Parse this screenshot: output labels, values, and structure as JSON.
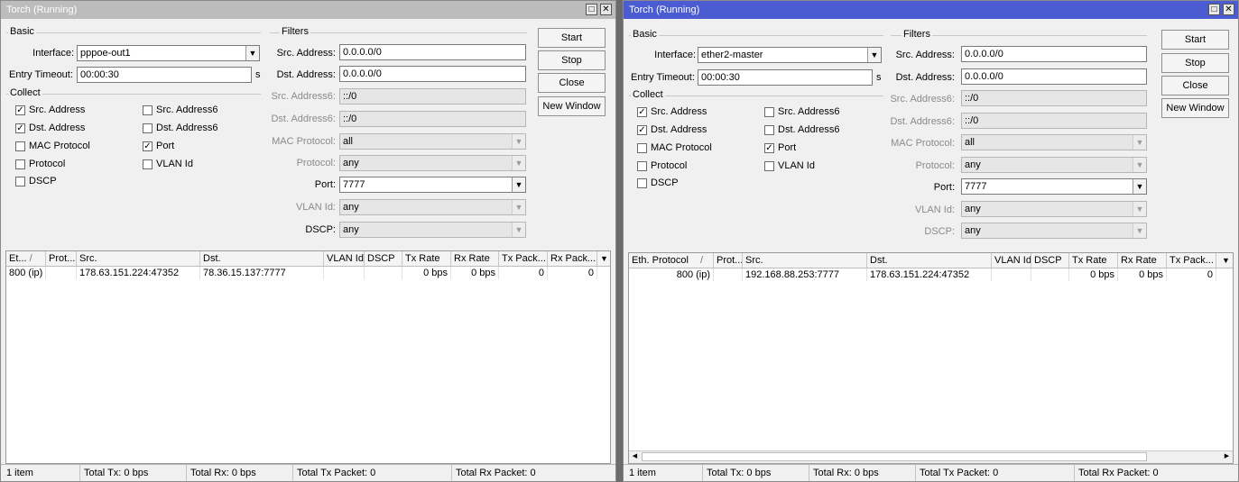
{
  "left": {
    "title": "Torch (Running)",
    "basic_label": "Basic",
    "interface_label": "Interface:",
    "interface_value": "pppoe-out1",
    "entry_timeout_label": "Entry Timeout:",
    "entry_timeout_value": "00:00:30",
    "entry_timeout_unit": "s",
    "collect_label": "Collect",
    "collect": [
      {
        "label": "Src. Address",
        "checked": true
      },
      {
        "label": "Src. Address6",
        "checked": false
      },
      {
        "label": "Dst. Address",
        "checked": true
      },
      {
        "label": "Dst. Address6",
        "checked": false
      },
      {
        "label": "MAC Protocol",
        "checked": false
      },
      {
        "label": "Port",
        "checked": true
      },
      {
        "label": "Protocol",
        "checked": false
      },
      {
        "label": "VLAN Id",
        "checked": false
      },
      {
        "label": "DSCP",
        "checked": false
      }
    ],
    "filters_label": "Filters",
    "filters": [
      {
        "label": "Src. Address:",
        "value": "0.0.0.0/0",
        "enabled": true,
        "dropdown": false
      },
      {
        "label": "Dst. Address:",
        "value": "0.0.0.0/0",
        "enabled": true,
        "dropdown": false
      },
      {
        "label": "Src. Address6:",
        "value": "::/0",
        "enabled": false,
        "dropdown": false
      },
      {
        "label": "Dst. Address6:",
        "value": "::/0",
        "enabled": false,
        "dropdown": false
      },
      {
        "label": "MAC Protocol:",
        "value": "all",
        "enabled": false,
        "dropdown": true
      },
      {
        "label": "Protocol:",
        "value": "any",
        "enabled": false,
        "dropdown": true
      },
      {
        "label": "Port:",
        "value": "7777",
        "enabled": true,
        "dropdown": true
      },
      {
        "label": "VLAN Id:",
        "value": "any",
        "enabled": false,
        "dropdown": true
      },
      {
        "label": "DSCP:",
        "value": "any",
        "enabled": false,
        "dropdown": true
      }
    ],
    "buttons": [
      "Start",
      "Stop",
      "Close",
      "New Window"
    ],
    "columns": [
      "Et...",
      "Prot...",
      "Src.",
      "Dst.",
      "VLAN Id",
      "DSCP",
      "Tx Rate",
      "Rx Rate",
      "Tx Pack...",
      "Rx Pack..."
    ],
    "sort_marker": "/",
    "rows": [
      [
        "800 (ip)",
        "",
        "178.63.151.224:47352",
        "78.36.15.137:7777",
        "",
        "",
        "0 bps",
        "0 bps",
        "0",
        "0"
      ]
    ],
    "status": [
      "1 item",
      "Total Tx: 0 bps",
      "Total Rx: 0 bps",
      "Total Tx Packet: 0",
      "Total Rx Packet: 0"
    ]
  },
  "right": {
    "title": "Torch (Running)",
    "basic_label": "Basic",
    "interface_label": "Interface:",
    "interface_value": "ether2-master",
    "entry_timeout_label": "Entry Timeout:",
    "entry_timeout_value": "00:00:30",
    "entry_timeout_unit": "s",
    "collect_label": "Collect",
    "collect": [
      {
        "label": "Src. Address",
        "checked": true
      },
      {
        "label": "Src. Address6",
        "checked": false
      },
      {
        "label": "Dst. Address",
        "checked": true
      },
      {
        "label": "Dst. Address6",
        "checked": false
      },
      {
        "label": "MAC Protocol",
        "checked": false
      },
      {
        "label": "Port",
        "checked": true
      },
      {
        "label": "Protocol",
        "checked": false
      },
      {
        "label": "VLAN Id",
        "checked": false
      },
      {
        "label": "DSCP",
        "checked": false
      }
    ],
    "filters_label": "Filters",
    "filters": [
      {
        "label": "Src. Address:",
        "value": "0.0.0.0/0",
        "enabled": true,
        "dropdown": false
      },
      {
        "label": "Dst. Address:",
        "value": "0.0.0.0/0",
        "enabled": true,
        "dropdown": false
      },
      {
        "label": "Src. Address6:",
        "value": "::/0",
        "enabled": false,
        "dropdown": false
      },
      {
        "label": "Dst. Address6:",
        "value": "::/0",
        "enabled": false,
        "dropdown": false
      },
      {
        "label": "MAC Protocol:",
        "value": "all",
        "enabled": false,
        "dropdown": true
      },
      {
        "label": "Protocol:",
        "value": "any",
        "enabled": false,
        "dropdown": true
      },
      {
        "label": "Port:",
        "value": "7777",
        "enabled": true,
        "dropdown": true
      },
      {
        "label": "VLAN Id:",
        "value": "any",
        "enabled": false,
        "dropdown": true
      },
      {
        "label": "DSCP:",
        "value": "any",
        "enabled": false,
        "dropdown": true
      }
    ],
    "buttons": [
      "Start",
      "Stop",
      "Close",
      "New Window"
    ],
    "columns": [
      "Eth. Protocol",
      "Prot...",
      "Src.",
      "Dst.",
      "VLAN Id",
      "DSCP",
      "Tx Rate",
      "Rx Rate",
      "Tx Pack..."
    ],
    "sort_marker": "/",
    "rows": [
      [
        "800 (ip)",
        "",
        "192.168.88.253:7777",
        "178.63.151.224:47352",
        "",
        "",
        "0 bps",
        "0 bps",
        "0"
      ]
    ],
    "status": [
      "1 item",
      "Total Tx: 0 bps",
      "Total Rx: 0 bps",
      "Total Tx Packet: 0",
      "Total Rx Packet: 0"
    ]
  },
  "icons": {
    "restore": "restore-icon",
    "close": "close-icon",
    "dropdown": "dropdown-arrow-icon",
    "check": "check-icon",
    "scroll_left": "scroll-left-icon",
    "scroll_right": "scroll-right-icon"
  },
  "colors": {
    "active_title": "#4b5bd2",
    "inactive_title": "#bcbcbc"
  }
}
